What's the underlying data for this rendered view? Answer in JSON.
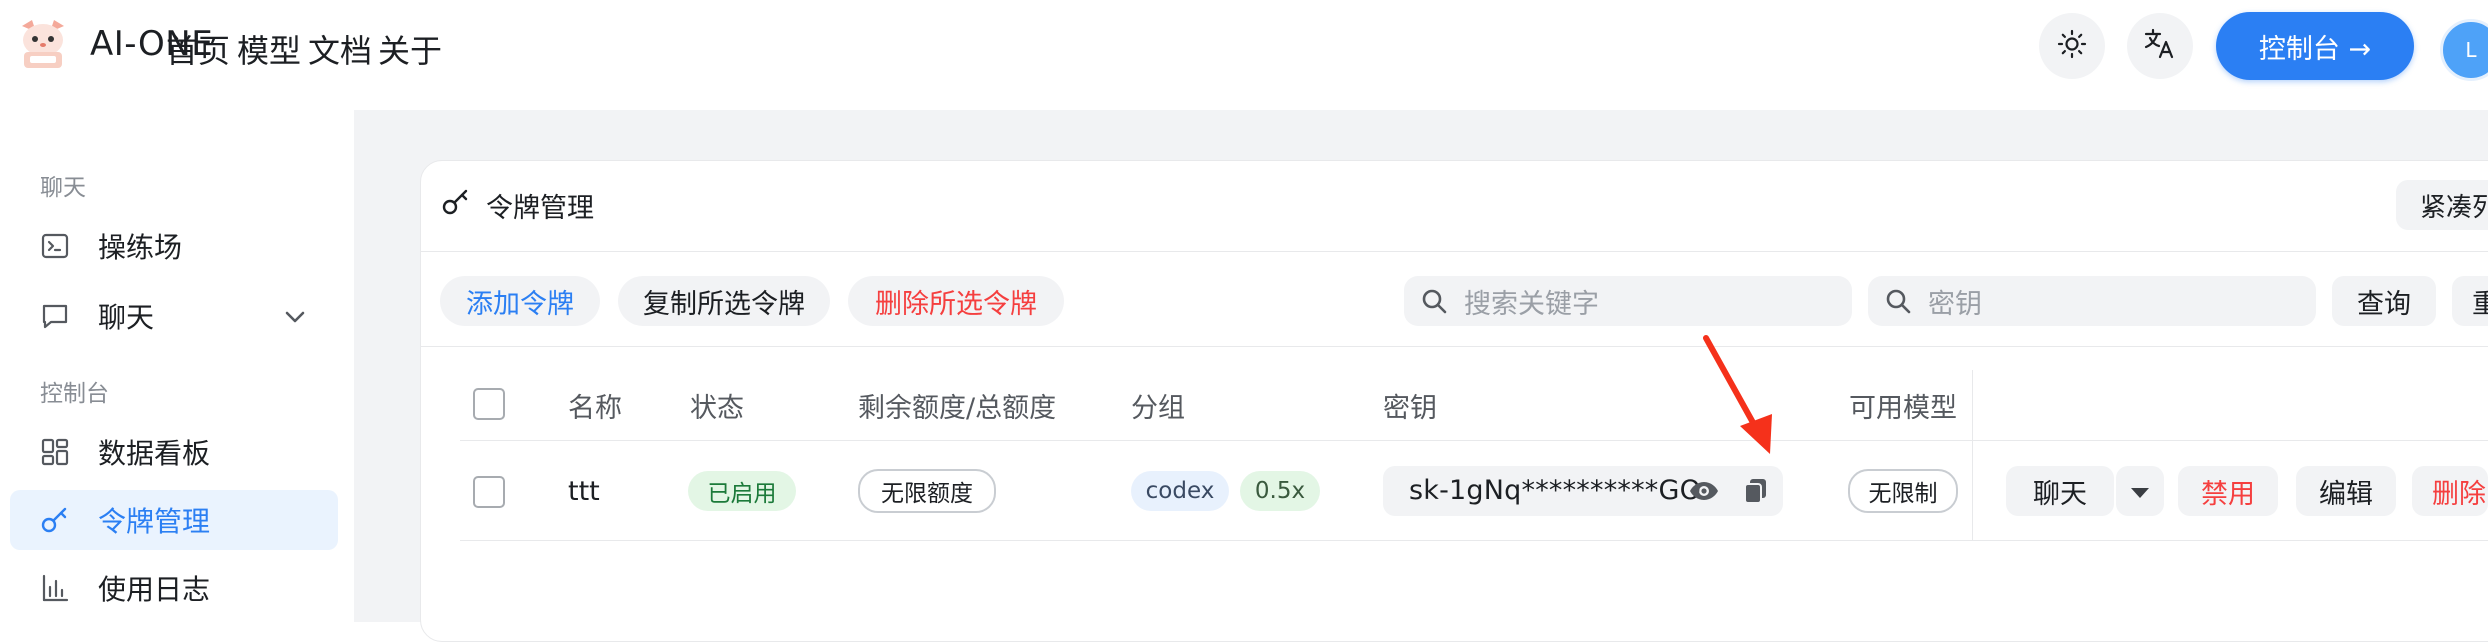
{
  "header": {
    "brand": "AI-ONE",
    "nav": [
      "首页",
      "模型",
      "文档",
      "关于"
    ],
    "console_button": "控制台 →",
    "avatar_letter": "L",
    "icons": [
      "sun-icon",
      "translate-icon"
    ]
  },
  "sidebar": {
    "group_chat": "聊天",
    "group_console": "控制台",
    "items": [
      {
        "label": "操练场",
        "icon": "terminal-icon"
      },
      {
        "label": "聊天",
        "icon": "chat-bubble-icon"
      },
      {
        "label": "数据看板",
        "icon": "dashboard-grid-icon"
      },
      {
        "label": "令牌管理",
        "icon": "key-icon",
        "active": true
      },
      {
        "label": "使用日志",
        "icon": "bar-chart-icon"
      }
    ]
  },
  "card": {
    "title": "令牌管理",
    "compact_button": "紧凑列"
  },
  "toolbar": {
    "add": "添加令牌",
    "copy_selected": "复制所选令牌",
    "delete_selected": "删除所选令牌",
    "search_placeholder": "搜索关键字",
    "key_placeholder": "密钥",
    "query": "查询",
    "reset": "重"
  },
  "table": {
    "headers": [
      "名称",
      "状态",
      "剩余额度/总额度",
      "分组",
      "密钥",
      "可用模型"
    ],
    "rows": [
      {
        "name": "ttt",
        "status": "已启用",
        "quota": "无限额度",
        "group": "codex",
        "ratio": "0.5x",
        "key": "sk-1gNq**********GO",
        "models": "无限制",
        "actions": {
          "chat": "聊天",
          "disable": "禁用",
          "edit": "编辑",
          "delete": "删除"
        }
      }
    ]
  },
  "colors": {
    "accent": "#2b7ff3",
    "danger": "#f53f3f",
    "success_bg": "#e3f6e5",
    "arrow": "#f5311b"
  }
}
